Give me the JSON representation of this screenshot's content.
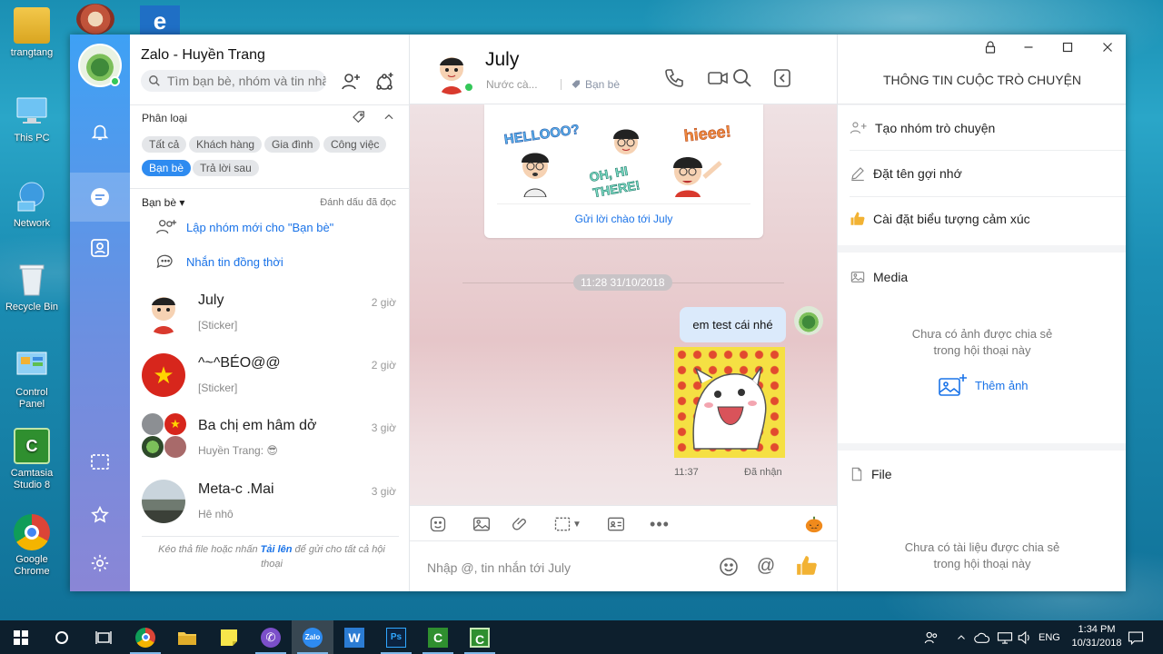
{
  "desktop": {
    "icons": [
      {
        "label": "trangtang"
      },
      {
        "label": "This PC"
      },
      {
        "label": "Network"
      },
      {
        "label": "Recycle Bin"
      },
      {
        "label": "Control Panel"
      },
      {
        "label": "Camtasia Studio 8"
      },
      {
        "label": "Google Chrome"
      }
    ]
  },
  "app": {
    "title": "Zalo - Huyền Trang",
    "search_placeholder": "Tìm bạn bè, nhóm và tin nhắn",
    "categories": {
      "label": "Phân loại",
      "chips": [
        "Tất cả",
        "Khách hàng",
        "Gia đình",
        "Công việc",
        "Bạn bè",
        "Trả lời sau"
      ],
      "selected": "Bạn bè"
    },
    "group": {
      "label": "Bạn bè",
      "mark_read": "Đánh dấu đã đọc",
      "actions": [
        "Lập nhóm mới cho \"Bạn bè\"",
        "Nhắn tin đồng thời"
      ]
    },
    "conversations": [
      {
        "name": "July",
        "preview": "[Sticker]",
        "time": "2 giờ"
      },
      {
        "name": "^~^BÉO@@",
        "preview": "[Sticker]",
        "time": "2 giờ"
      },
      {
        "name": "Ba chị em hâm dở",
        "preview": "Huyền Trang: 😎",
        "time": "3 giờ"
      },
      {
        "name": "Meta-c .Mai",
        "preview": "Hê nhô",
        "time": "3 giờ"
      }
    ],
    "drop_hint": {
      "before": "Kéo thả file hoặc nhấn ",
      "link": "Tải lên",
      "after": " để gửi cho tất cả hội thoại"
    }
  },
  "chat": {
    "name": "July",
    "status": "Nước cà...",
    "tag": "Bạn bè",
    "sticker_texts": [
      "HELLOOO?",
      "OH, HI THERE!",
      "hieee!"
    ],
    "greet_link": "Gửi lời chào tới July",
    "date_separator": "11:28 31/10/2018",
    "messages": [
      {
        "text": "em test cái nhé",
        "type": "text"
      },
      {
        "type": "sticker",
        "time": "11:37",
        "status": "Đã nhận"
      }
    ],
    "compose_placeholder": "Nhập @, tin nhắn tới July"
  },
  "info": {
    "title": "THÔNG TIN CUỘC TRÒ CHUYỆN",
    "rows": [
      "Tạo nhóm trò chuyện",
      "Đặt tên gợi nhớ",
      "Cài đặt biểu tượng cảm xúc"
    ],
    "media": {
      "label": "Media",
      "empty": "Chưa có ảnh được chia sẻ trong hội thoại này",
      "add": "Thêm ảnh"
    },
    "file": {
      "label": "File",
      "empty": "Chưa có tài liệu được chia sẻ trong hội thoại này"
    }
  },
  "taskbar": {
    "language": "ENG",
    "time": "1:34 PM",
    "date": "10/31/2018",
    "apps": [
      "Chrome",
      "File Explorer",
      "Sticky Notes",
      "Viber",
      "Zalo",
      "Word",
      "Photoshop",
      "Camtasia Studio",
      "Camtasia Recorder"
    ]
  },
  "colors": {
    "accent": "#2e8bf0",
    "rail_top": "#3ea1f5",
    "rail_bottom": "#8a86d6",
    "link": "#1a73e8",
    "online": "#34c759"
  }
}
